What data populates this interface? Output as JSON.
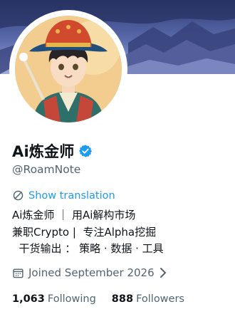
{
  "profile": {
    "display_name": "Ai炼金师",
    "handle": "@RoamNote",
    "verified_icon": "verified-badge-icon",
    "translate_label": "Show translation",
    "bio_lines": [
      "Ai炼金师 ｜ 用Ai解构市场",
      "兼职Crypto |  专注Alpha挖掘",
      "  干货输出 ： 策略 · 数据 · 工具"
    ],
    "joined": "Joined September 2026",
    "following_count": "1,063",
    "following_label": "Following",
    "followers_count": "888",
    "followers_label": "Followers"
  },
  "colors": {
    "accent": "#1d9bf0",
    "muted_text": "#536471",
    "primary_text": "#0f1419",
    "banner": "#4d5fa0"
  }
}
